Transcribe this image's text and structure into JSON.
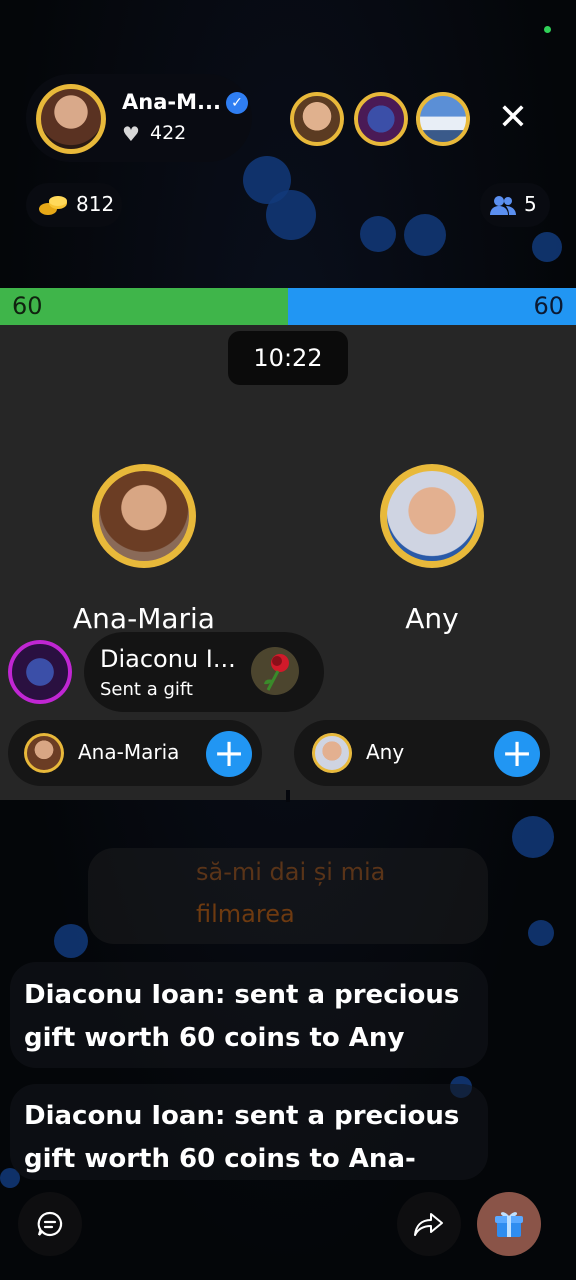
{
  "host": {
    "name": "Ana-M...",
    "likes": "422",
    "verified_icon": "verified-badge-icon",
    "heart_icon": "heart-icon"
  },
  "top_viewers": [
    "viewer-avatar-1",
    "viewer-avatar-2",
    "viewer-avatar-3"
  ],
  "close_icon": "✕",
  "stats": {
    "coins": "812",
    "viewers": "5"
  },
  "battle": {
    "score_left": "60",
    "score_right": "60",
    "timer": "10:22",
    "left_name": "Ana-Maria",
    "right_name": "Any",
    "colors": {
      "left": "#3fb54a",
      "right": "#2196f3"
    }
  },
  "gift_toast": {
    "sender": "Diaconu I...",
    "subtitle": "Sent a gift",
    "gift_icon": "rose-icon"
  },
  "follow": [
    {
      "name": "Ana-Maria",
      "button": "+"
    },
    {
      "name": "Any",
      "button": "+"
    }
  ],
  "chat": {
    "ghost_lines": [
      "să-mi dai și mia",
      "filmarea"
    ],
    "messages": [
      "Diaconu Ioan: sent a precious gift worth 60 coins to Any",
      "Diaconu Ioan: sent a precious gift worth 60 coins to Ana-"
    ]
  },
  "bottom": {
    "chat_icon": "chat-icon",
    "share_icon": "share-icon",
    "gift_icon": "gift-icon"
  }
}
